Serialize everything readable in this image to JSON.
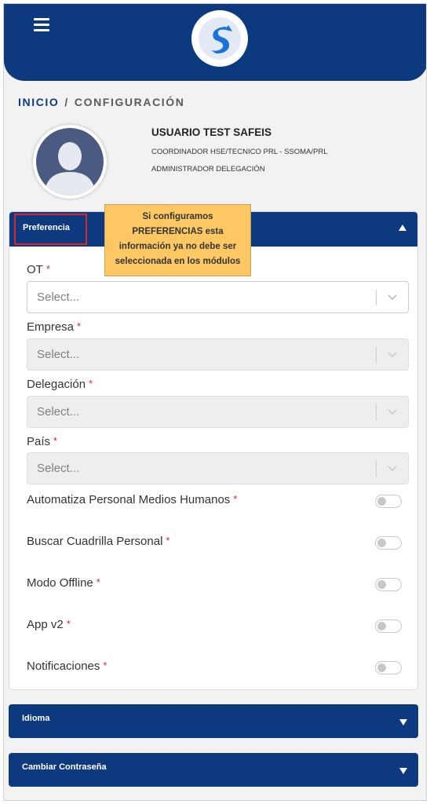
{
  "header": {
    "menu_icon": "hamburger-menu-icon",
    "logo_icon": "safeis-s-logo-icon",
    "brand_color": "#0d3a7f"
  },
  "breadcrumb": {
    "home": "INICIO",
    "separator": "/",
    "current": "CONFIGURACIÓN"
  },
  "profile": {
    "avatar_icon": "user-avatar-icon",
    "name": "USUARIO TEST SAFEIS",
    "role": "COORDINADOR HSE/TECNICO PRL - SSOMA/PRL",
    "admin": "ADMINISTRADOR DELEGACIÓN"
  },
  "preferencia": {
    "title": "Preferencia",
    "expanded": true,
    "tooltip_lines": [
      "Si configuramos",
      "PREFERENCIAS esta",
      "información ya no debe ser",
      "seleccionada en los módulos"
    ],
    "fields": [
      {
        "label": "OT",
        "required": "*",
        "placeholder": "Select...",
        "disabled": false
      },
      {
        "label": "Empresa",
        "required": "*",
        "placeholder": "Select...",
        "disabled": true
      },
      {
        "label": "Delegación",
        "required": "*",
        "placeholder": "Select...",
        "disabled": true
      },
      {
        "label": "País",
        "required": "*",
        "placeholder": "Select...",
        "disabled": true
      }
    ],
    "toggles": [
      {
        "label": "Automatiza Personal Medios Humanos",
        "required": "*",
        "on": false
      },
      {
        "label": "Buscar Cuadrilla Personal",
        "required": "*",
        "on": false
      },
      {
        "label": "Modo Offline",
        "required": "*",
        "on": false
      },
      {
        "label": "App v2",
        "required": "*",
        "on": false
      },
      {
        "label": "Notificaciones",
        "required": "*",
        "on": false
      }
    ]
  },
  "sections": [
    {
      "title": "Idioma",
      "expanded": false
    },
    {
      "title": "Cambiar Contraseña",
      "expanded": false
    }
  ],
  "colors": {
    "required": "#d9262b",
    "tooltip_bg": "#fdc763",
    "highlight_border": "#d9262b"
  }
}
